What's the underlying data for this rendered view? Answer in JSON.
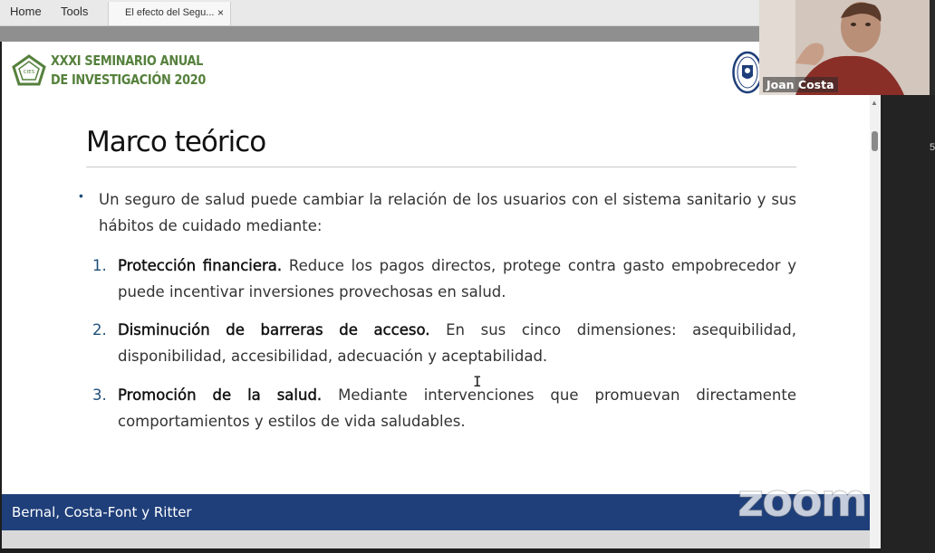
{
  "menu": {
    "home_label": "Home",
    "tools_label": "Tools"
  },
  "tab": {
    "label": "El efecto del Segu...",
    "close_label": "×"
  },
  "slide": {
    "seminar_line1": "XXXI SEMINARIO ANUAL",
    "seminar_line2": "DE INVESTIGACIÓN 2020",
    "title": "Marco teórico",
    "intro_bullet": "•",
    "intro": "Un seguro de salud puede cambiar la relación de los usuarios con el sistema sanitario y sus hábitos de cuidado mediante:",
    "items": [
      {
        "number": "1.",
        "heading": "Protección financiera.",
        "text": " Reduce los pagos directos, protege contra gasto empobrecedor y puede incentivar inversiones provechosas en salud."
      },
      {
        "number": "2.",
        "heading": "Disminución de barreras de acceso.",
        "text": " En sus cinco dimensiones: asequibilidad, disponibilidad, accesibilidad, adecuación y aceptabilidad."
      },
      {
        "number": "3.",
        "heading": "Promoción de la salud.",
        "text": " Mediante intervenciones que promuevan directamente comportamientos y estilos de vida saludables."
      }
    ],
    "footer": "Bernal, Costa-Font y Ritter"
  },
  "video": {
    "participant_name": "Joan Costa"
  },
  "side_panel": {
    "glyph": "5"
  },
  "watermark": {
    "text": "zoom"
  },
  "colors": {
    "seminar_green": "#56813d",
    "footer_blue": "#1f3f7a",
    "list_number_blue": "#1f4e79"
  },
  "icons": {
    "logo_left": "cies-pentagon-logo",
    "logo_right": "university-seal-logo",
    "text_cursor": "i-beam-cursor-icon",
    "scroll_up": "scroll-up-arrow-icon"
  }
}
